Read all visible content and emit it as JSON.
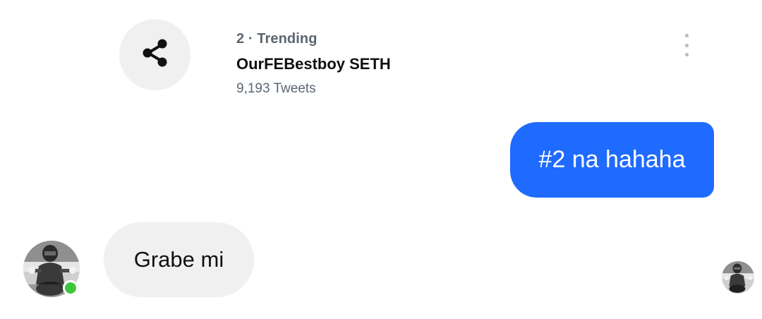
{
  "shared_trend": {
    "share_icon": "share-icon",
    "meta": "2 · Trending",
    "title": "OurFEBestboy SETH",
    "count": "9,193 Tweets",
    "menu_icon": "more-vertical-icon"
  },
  "messages": [
    {
      "direction": "outgoing",
      "text": "#2 na hahaha",
      "bubble_color": "#1f6bff"
    },
    {
      "direction": "incoming",
      "text": "Grabe mi",
      "bubble_color": "#f0f0f0"
    }
  ],
  "sender": {
    "avatar_icon": "contact-avatar",
    "online": true,
    "online_color": "#3ec63a"
  },
  "read_receipt": {
    "avatar_icon": "seen-avatar"
  }
}
